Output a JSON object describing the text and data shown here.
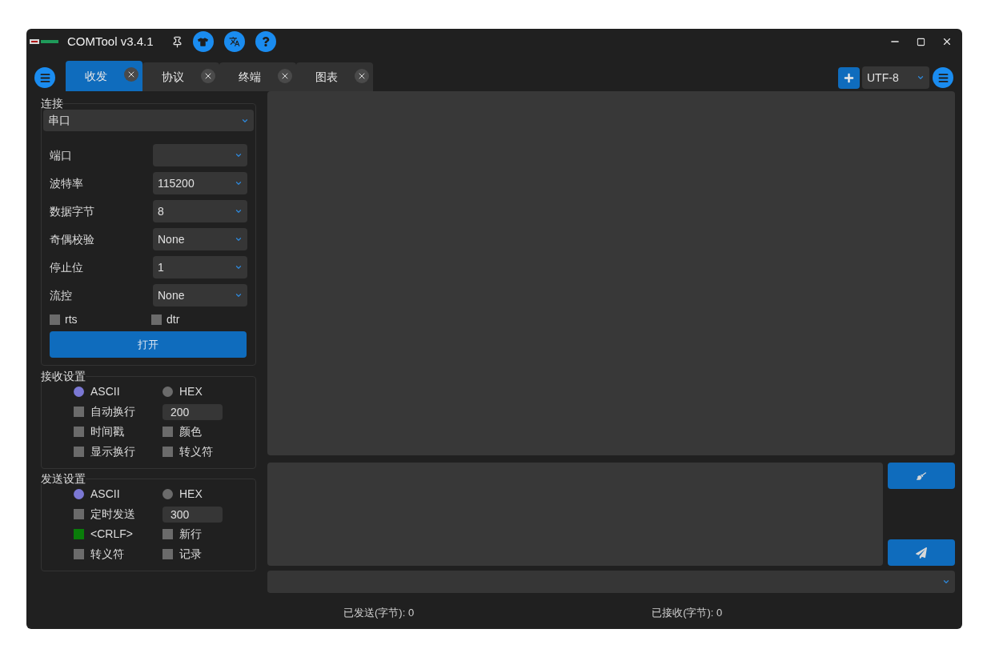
{
  "window": {
    "title": "COMTool v3.4.1"
  },
  "tabs": [
    {
      "label": "收发",
      "selected": true
    },
    {
      "label": "协议",
      "selected": false
    },
    {
      "label": "终端",
      "selected": false
    },
    {
      "label": "图表",
      "selected": false
    }
  ],
  "encoding": {
    "value": "UTF-8"
  },
  "connection": {
    "title": "连接",
    "type": "串口",
    "settings": [
      {
        "label": "端口"
      },
      {
        "label": "波特率",
        "value": "115200"
      },
      {
        "label": "数据字节",
        "value": "8"
      },
      {
        "label": "奇偶校验",
        "value": "None"
      },
      {
        "label": "停止位",
        "value": "1"
      },
      {
        "label": "流控",
        "value": "None"
      }
    ],
    "flags": [
      {
        "label": "rts",
        "checked": false
      },
      {
        "label": "dtr",
        "checked": false
      }
    ],
    "open_button": "打开"
  },
  "receive_settings": {
    "title": "接收设置",
    "options": [
      {
        "kind": "radio",
        "label": "ASCII",
        "selected": true
      },
      {
        "kind": "radio",
        "label": "HEX",
        "selected": false
      },
      {
        "kind": "checkbox",
        "label": "自动换行",
        "checked": false
      },
      {
        "kind": "field",
        "value": "200"
      },
      {
        "kind": "checkbox",
        "label": "时间戳",
        "checked": false
      },
      {
        "kind": "checkbox",
        "label": "颜色",
        "checked": false
      },
      {
        "kind": "checkbox",
        "label": "显示换行",
        "checked": false
      },
      {
        "kind": "checkbox",
        "label": "转义符",
        "checked": false
      }
    ]
  },
  "send_settings": {
    "title": "发送设置",
    "options": [
      {
        "kind": "radio",
        "label": "ASCII",
        "selected": true
      },
      {
        "kind": "radio",
        "label": "HEX",
        "selected": false
      },
      {
        "kind": "checkbox",
        "label": "定时发送",
        "checked": false
      },
      {
        "kind": "field",
        "value": "300"
      },
      {
        "kind": "checkbox",
        "label": "<CRLF>",
        "checked": true
      },
      {
        "kind": "checkbox",
        "label": "新行",
        "checked": false
      },
      {
        "kind": "checkbox",
        "label": "转义符",
        "checked": false
      },
      {
        "kind": "checkbox",
        "label": "记录",
        "checked": false
      }
    ]
  },
  "status_bar": {
    "sent": "已发送(字节): 0",
    "received": "已接收(字节): 0"
  }
}
